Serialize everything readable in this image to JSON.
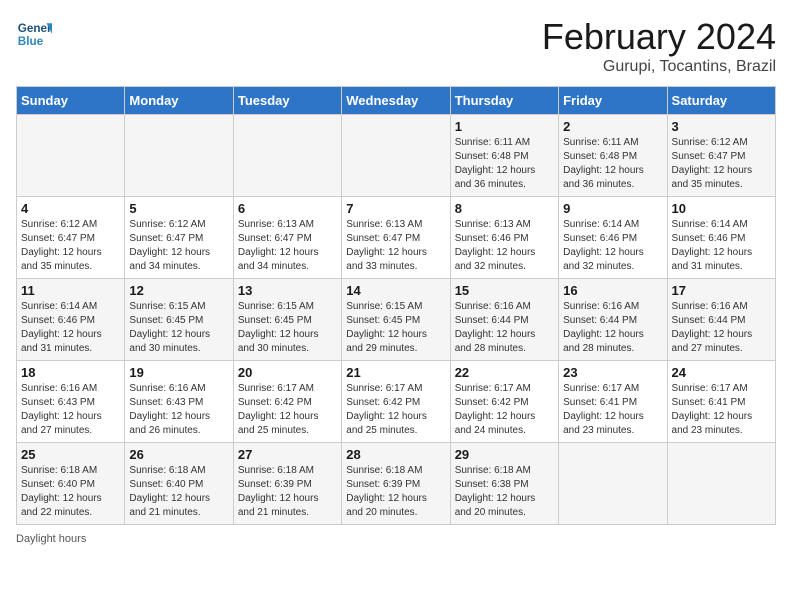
{
  "header": {
    "logo_line1": "General",
    "logo_line2": "Blue",
    "month": "February 2024",
    "location": "Gurupi, Tocantins, Brazil"
  },
  "days_of_week": [
    "Sunday",
    "Monday",
    "Tuesday",
    "Wednesday",
    "Thursday",
    "Friday",
    "Saturday"
  ],
  "footer": {
    "note": "Daylight hours"
  },
  "weeks": [
    [
      {
        "day": "",
        "info": ""
      },
      {
        "day": "",
        "info": ""
      },
      {
        "day": "",
        "info": ""
      },
      {
        "day": "",
        "info": ""
      },
      {
        "day": "1",
        "info": "Sunrise: 6:11 AM\nSunset: 6:48 PM\nDaylight: 12 hours and 36 minutes."
      },
      {
        "day": "2",
        "info": "Sunrise: 6:11 AM\nSunset: 6:48 PM\nDaylight: 12 hours and 36 minutes."
      },
      {
        "day": "3",
        "info": "Sunrise: 6:12 AM\nSunset: 6:47 PM\nDaylight: 12 hours and 35 minutes."
      }
    ],
    [
      {
        "day": "4",
        "info": "Sunrise: 6:12 AM\nSunset: 6:47 PM\nDaylight: 12 hours and 35 minutes."
      },
      {
        "day": "5",
        "info": "Sunrise: 6:12 AM\nSunset: 6:47 PM\nDaylight: 12 hours and 34 minutes."
      },
      {
        "day": "6",
        "info": "Sunrise: 6:13 AM\nSunset: 6:47 PM\nDaylight: 12 hours and 34 minutes."
      },
      {
        "day": "7",
        "info": "Sunrise: 6:13 AM\nSunset: 6:47 PM\nDaylight: 12 hours and 33 minutes."
      },
      {
        "day": "8",
        "info": "Sunrise: 6:13 AM\nSunset: 6:46 PM\nDaylight: 12 hours and 32 minutes."
      },
      {
        "day": "9",
        "info": "Sunrise: 6:14 AM\nSunset: 6:46 PM\nDaylight: 12 hours and 32 minutes."
      },
      {
        "day": "10",
        "info": "Sunrise: 6:14 AM\nSunset: 6:46 PM\nDaylight: 12 hours and 31 minutes."
      }
    ],
    [
      {
        "day": "11",
        "info": "Sunrise: 6:14 AM\nSunset: 6:46 PM\nDaylight: 12 hours and 31 minutes."
      },
      {
        "day": "12",
        "info": "Sunrise: 6:15 AM\nSunset: 6:45 PM\nDaylight: 12 hours and 30 minutes."
      },
      {
        "day": "13",
        "info": "Sunrise: 6:15 AM\nSunset: 6:45 PM\nDaylight: 12 hours and 30 minutes."
      },
      {
        "day": "14",
        "info": "Sunrise: 6:15 AM\nSunset: 6:45 PM\nDaylight: 12 hours and 29 minutes."
      },
      {
        "day": "15",
        "info": "Sunrise: 6:16 AM\nSunset: 6:44 PM\nDaylight: 12 hours and 28 minutes."
      },
      {
        "day": "16",
        "info": "Sunrise: 6:16 AM\nSunset: 6:44 PM\nDaylight: 12 hours and 28 minutes."
      },
      {
        "day": "17",
        "info": "Sunrise: 6:16 AM\nSunset: 6:44 PM\nDaylight: 12 hours and 27 minutes."
      }
    ],
    [
      {
        "day": "18",
        "info": "Sunrise: 6:16 AM\nSunset: 6:43 PM\nDaylight: 12 hours and 27 minutes."
      },
      {
        "day": "19",
        "info": "Sunrise: 6:16 AM\nSunset: 6:43 PM\nDaylight: 12 hours and 26 minutes."
      },
      {
        "day": "20",
        "info": "Sunrise: 6:17 AM\nSunset: 6:42 PM\nDaylight: 12 hours and 25 minutes."
      },
      {
        "day": "21",
        "info": "Sunrise: 6:17 AM\nSunset: 6:42 PM\nDaylight: 12 hours and 25 minutes."
      },
      {
        "day": "22",
        "info": "Sunrise: 6:17 AM\nSunset: 6:42 PM\nDaylight: 12 hours and 24 minutes."
      },
      {
        "day": "23",
        "info": "Sunrise: 6:17 AM\nSunset: 6:41 PM\nDaylight: 12 hours and 23 minutes."
      },
      {
        "day": "24",
        "info": "Sunrise: 6:17 AM\nSunset: 6:41 PM\nDaylight: 12 hours and 23 minutes."
      }
    ],
    [
      {
        "day": "25",
        "info": "Sunrise: 6:18 AM\nSunset: 6:40 PM\nDaylight: 12 hours and 22 minutes."
      },
      {
        "day": "26",
        "info": "Sunrise: 6:18 AM\nSunset: 6:40 PM\nDaylight: 12 hours and 21 minutes."
      },
      {
        "day": "27",
        "info": "Sunrise: 6:18 AM\nSunset: 6:39 PM\nDaylight: 12 hours and 21 minutes."
      },
      {
        "day": "28",
        "info": "Sunrise: 6:18 AM\nSunset: 6:39 PM\nDaylight: 12 hours and 20 minutes."
      },
      {
        "day": "29",
        "info": "Sunrise: 6:18 AM\nSunset: 6:38 PM\nDaylight: 12 hours and 20 minutes."
      },
      {
        "day": "",
        "info": ""
      },
      {
        "day": "",
        "info": ""
      }
    ]
  ]
}
